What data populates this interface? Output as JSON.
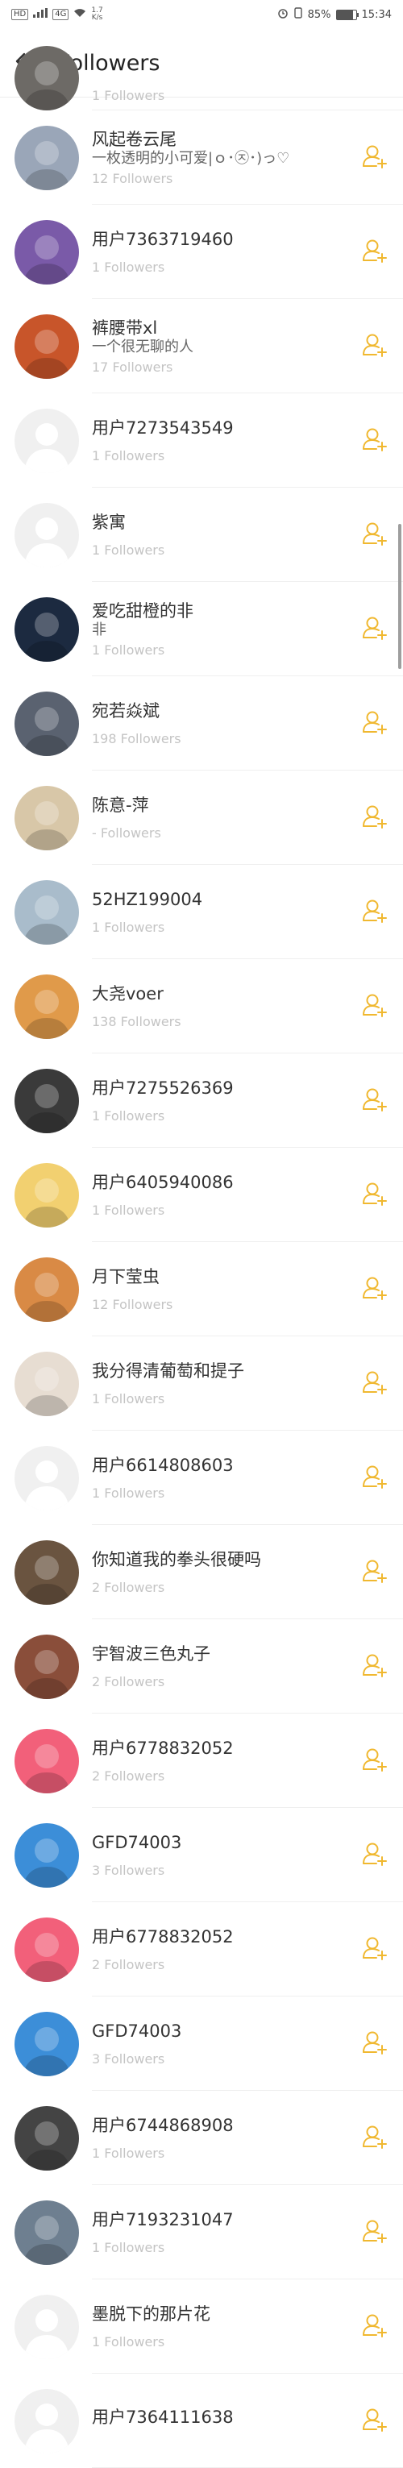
{
  "status_bar": {
    "left_chips": [
      "HD",
      "4G"
    ],
    "speed_value": "1.7",
    "speed_unit": "K/s",
    "battery": "85%",
    "battery_level": 0.85,
    "time": "15:34"
  },
  "header": {
    "title": "Followers",
    "back_icon": "arrow-left-icon"
  },
  "colors": {
    "follow_icon": "#f0b830",
    "divider": "#efefef"
  },
  "followers": [
    {
      "name": "",
      "signature": "",
      "count": "1 Followers",
      "avatar": "#6d6a66",
      "partial": true
    },
    {
      "name": "风起卷云尾",
      "signature": "一枚透明的小可爱|ｏ･㉨･)っ♡",
      "count": "12 Followers",
      "avatar": "#9aa6b8"
    },
    {
      "name": "用户7363719460",
      "signature": "",
      "count": "1 Followers",
      "avatar": "#7a5aa8"
    },
    {
      "name": "裤腰带xl",
      "signature": "一个很无聊的人",
      "count": "17 Followers",
      "avatar": "#c8552a"
    },
    {
      "name": "用户7273543549",
      "signature": "",
      "count": "1 Followers",
      "avatar": "#eeeeee"
    },
    {
      "name": "紫寓",
      "signature": "",
      "count": "1 Followers",
      "avatar": "#eeeeee"
    },
    {
      "name": "爱吃甜橙的非",
      "signature": "非",
      "count": "1 Followers",
      "avatar": "#1c2a40"
    },
    {
      "name": "宛若焱斌",
      "signature": "",
      "count": "198 Followers",
      "avatar": "#5a6270"
    },
    {
      "name": "陈意-萍",
      "signature": "",
      "count": "- Followers",
      "avatar": "#d8c7a8"
    },
    {
      "name": "52HZ199004",
      "signature": "",
      "count": "1 Followers",
      "avatar": "#a9bccb"
    },
    {
      "name": "大尧voer",
      "signature": "",
      "count": "138 Followers",
      "avatar": "#e09a4a"
    },
    {
      "name": "用户7275526369",
      "signature": "",
      "count": "1 Followers",
      "avatar": "#3a3a3a"
    },
    {
      "name": "用户6405940086",
      "signature": "",
      "count": "1 Followers",
      "avatar": "#f2d070"
    },
    {
      "name": "月下莹虫",
      "signature": "",
      "count": "12 Followers",
      "avatar": "#d98a45"
    },
    {
      "name": "我分得清葡萄和提子",
      "signature": "",
      "count": "1 Followers",
      "avatar": "#e7ddd2"
    },
    {
      "name": "用户6614808603",
      "signature": "",
      "count": "1 Followers",
      "avatar": "#eeeeee"
    },
    {
      "name": "你知道我的拳头很硬吗",
      "signature": "",
      "count": "2 Followers",
      "avatar": "#6a5440"
    },
    {
      "name": "宇智波三色丸子",
      "signature": "",
      "count": "2 Followers",
      "avatar": "#8a4e3a"
    },
    {
      "name": "用户6778832052",
      "signature": "",
      "count": "2 Followers",
      "avatar": "#f2607a"
    },
    {
      "name": "GFD74003",
      "signature": "",
      "count": "3 Followers",
      "avatar": "#3c8ed8"
    },
    {
      "name": "用户6778832052",
      "signature": "",
      "count": "2 Followers",
      "avatar": "#f2607a"
    },
    {
      "name": "GFD74003",
      "signature": "",
      "count": "3 Followers",
      "avatar": "#3c8ed8"
    },
    {
      "name": "用户6744868908",
      "signature": "",
      "count": "1 Followers",
      "avatar": "#444444"
    },
    {
      "name": "用户7193231047",
      "signature": "",
      "count": "1 Followers",
      "avatar": "#6e7f90"
    },
    {
      "name": "墨脱下的那片花",
      "signature": "",
      "count": "1 Followers",
      "avatar": "#eeeeee"
    },
    {
      "name": "用户7364111638",
      "signature": "",
      "count": "",
      "avatar": "#eeeeee",
      "partial": true
    }
  ]
}
